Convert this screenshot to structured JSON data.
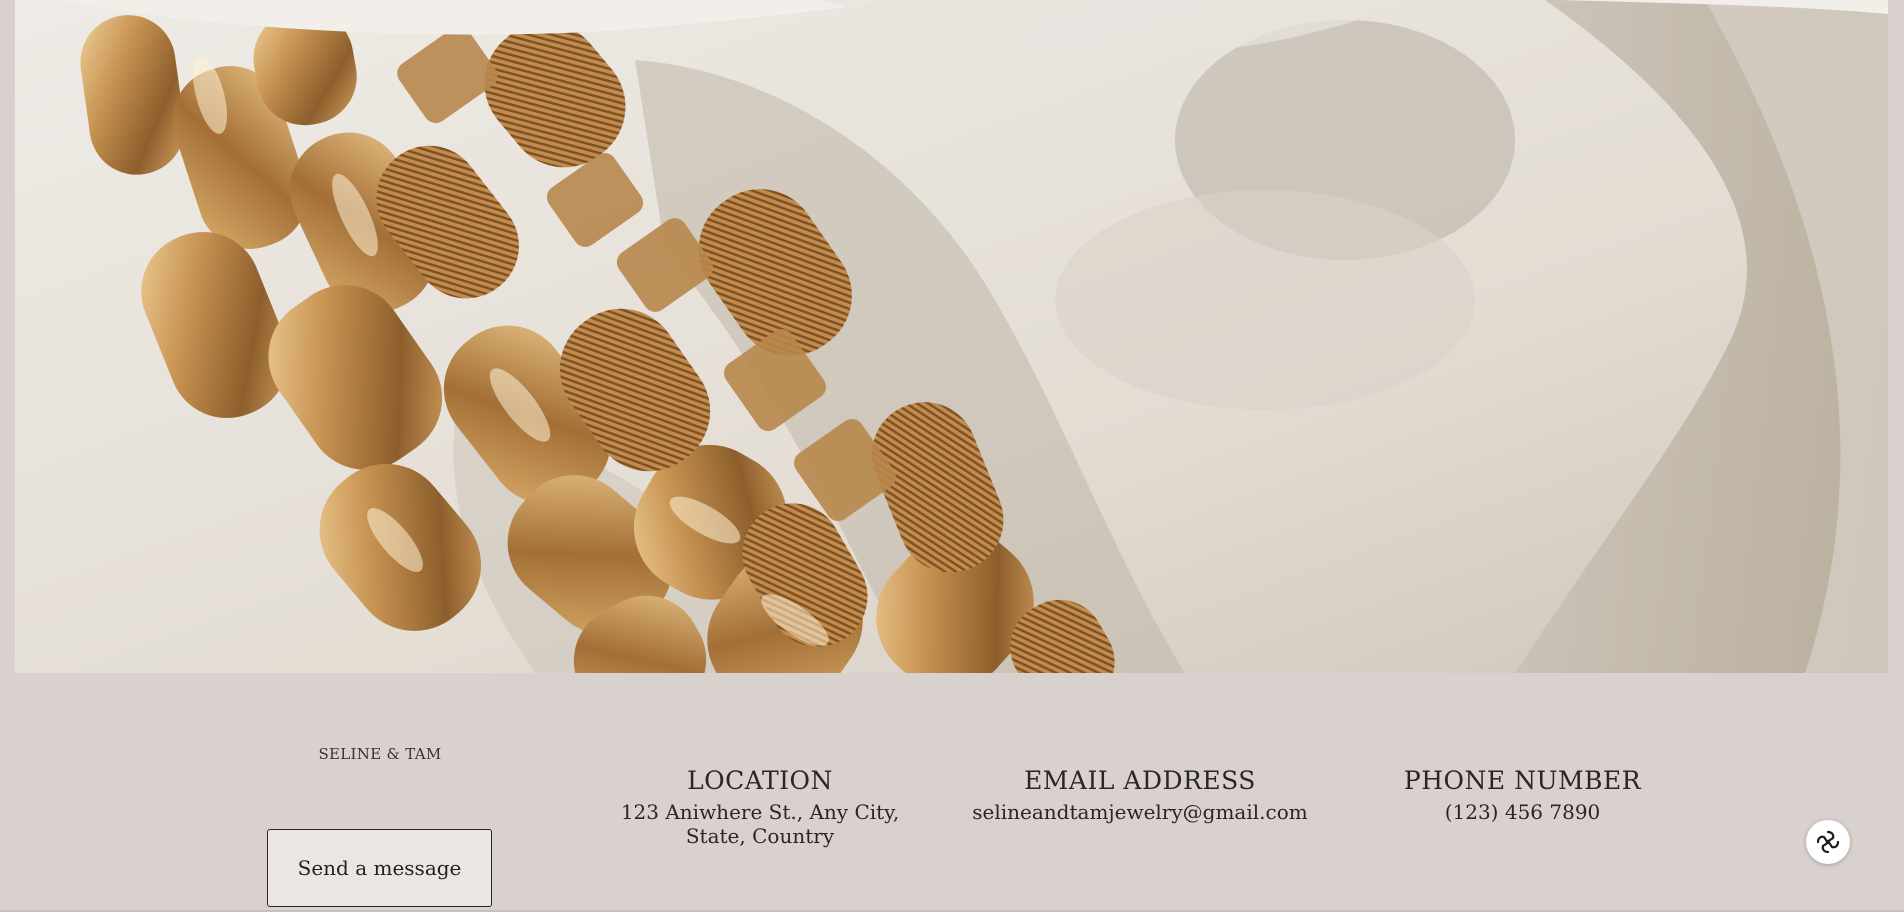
{
  "hero": {
    "image": "gold-chain-bracelet-on-white-stone"
  },
  "footer": {
    "brand": "SELINE & TAM",
    "send_button": "Send a message",
    "location": {
      "heading": "LOCATION",
      "value": "123 Aniwhere St., Any City, State, Country"
    },
    "email": {
      "heading": "EMAIL ADDRESS",
      "value": "selineandtamjewelry@gmail.com"
    },
    "phone": {
      "heading": "PHONE NUMBER",
      "value": "(123) 456 7890"
    }
  },
  "chat_widget": {
    "icon": "chat-assistant-icon"
  },
  "colors": {
    "background": "#d8d1cd",
    "button_bg": "#ebe6e3",
    "text": "#2b2624",
    "gold": "#c99a5b"
  }
}
